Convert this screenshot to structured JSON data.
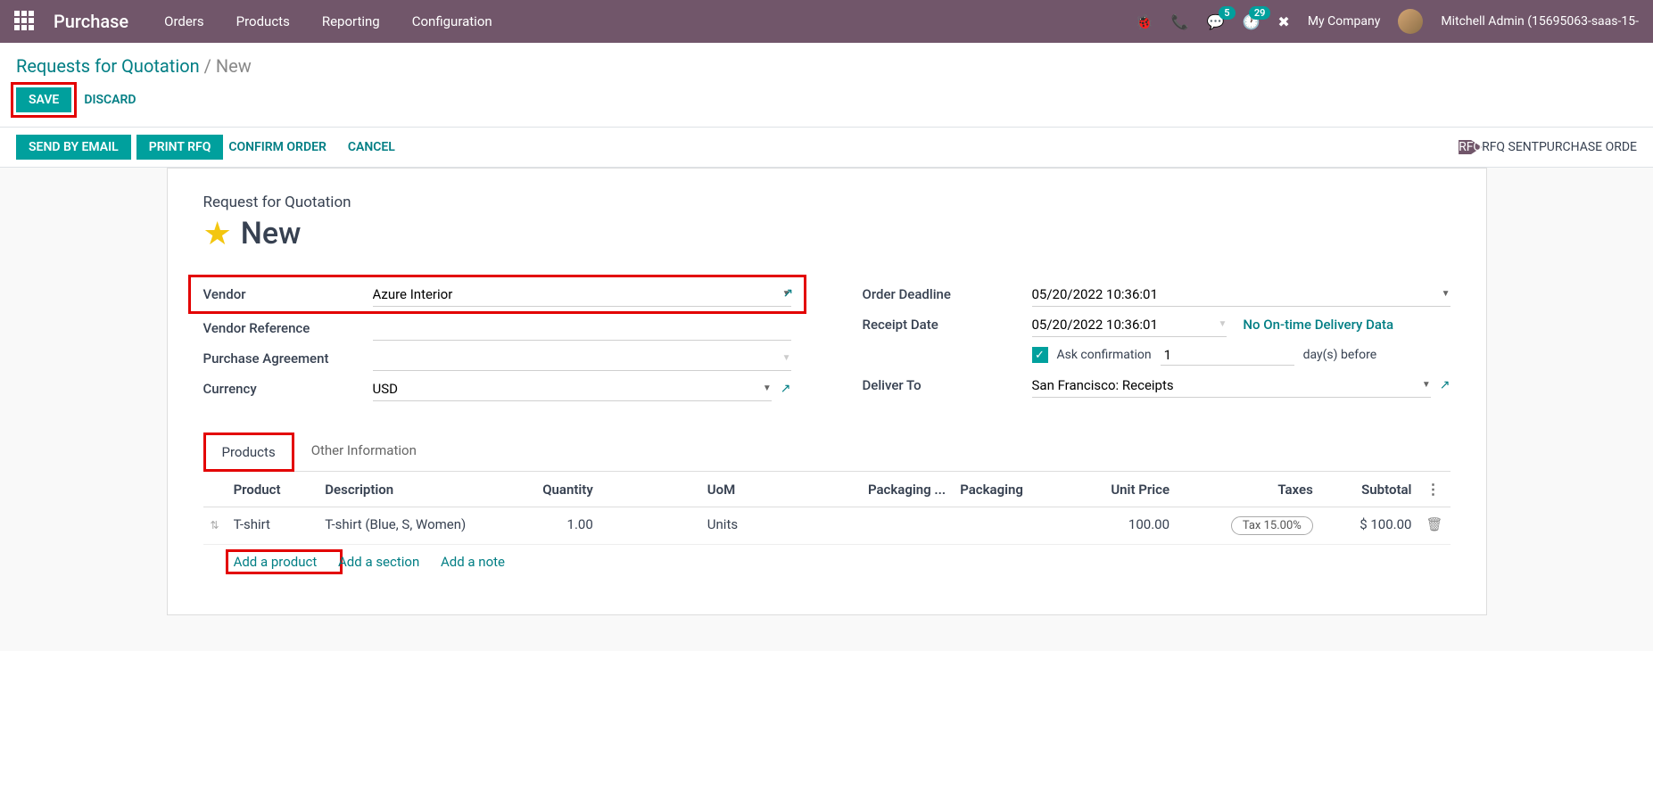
{
  "nav": {
    "brand": "Purchase",
    "menu": [
      "Orders",
      "Products",
      "Reporting",
      "Configuration"
    ],
    "messages_badge": "5",
    "activities_badge": "29",
    "company": "My Company",
    "user": "Mitchell Admin (15695063-saas-15-"
  },
  "breadcrumb": {
    "parent": "Requests for Quotation",
    "current": "New"
  },
  "buttons": {
    "save": "SAVE",
    "discard": "DISCARD",
    "send_email": "SEND BY EMAIL",
    "print_rfq": "PRINT RFQ",
    "confirm": "CONFIRM ORDER",
    "cancel": "CANCEL"
  },
  "status": {
    "steps": [
      "RFQ",
      "RFQ SENT",
      "PURCHASE ORDE"
    ]
  },
  "form": {
    "title_label": "Request for Quotation",
    "title": "New",
    "labels": {
      "vendor": "Vendor",
      "vendor_ref": "Vendor Reference",
      "agreement": "Purchase Agreement",
      "currency": "Currency",
      "deadline": "Order Deadline",
      "receipt": "Receipt Date",
      "deliver_to": "Deliver To",
      "ask_confirm": "Ask confirmation",
      "days_before": "day(s) before"
    },
    "values": {
      "vendor": "Azure Interior",
      "vendor_ref": "",
      "agreement": "",
      "currency": "USD",
      "deadline": "05/20/2022 10:36:01",
      "receipt": "05/20/2022 10:36:01",
      "ontime_link": "No On-time Delivery Data",
      "ask_confirm_days": "1",
      "deliver_to": "San Francisco: Receipts"
    }
  },
  "tabs": {
    "products": "Products",
    "other": "Other Information"
  },
  "table": {
    "headers": {
      "product": "Product",
      "description": "Description",
      "quantity": "Quantity",
      "uom": "UoM",
      "packaging_q": "Packaging ...",
      "packaging": "Packaging",
      "unit_price": "Unit Price",
      "taxes": "Taxes",
      "subtotal": "Subtotal"
    },
    "rows": [
      {
        "product": "T-shirt",
        "description": "T-shirt (Blue, S, Women)",
        "quantity": "1.00",
        "uom": "Units",
        "packaging_q": "",
        "packaging": "",
        "unit_price": "100.00",
        "taxes": "Tax 15.00%",
        "subtotal": "$ 100.00"
      }
    ],
    "add_product": "Add a product",
    "add_section": "Add a section",
    "add_note": "Add a note"
  }
}
